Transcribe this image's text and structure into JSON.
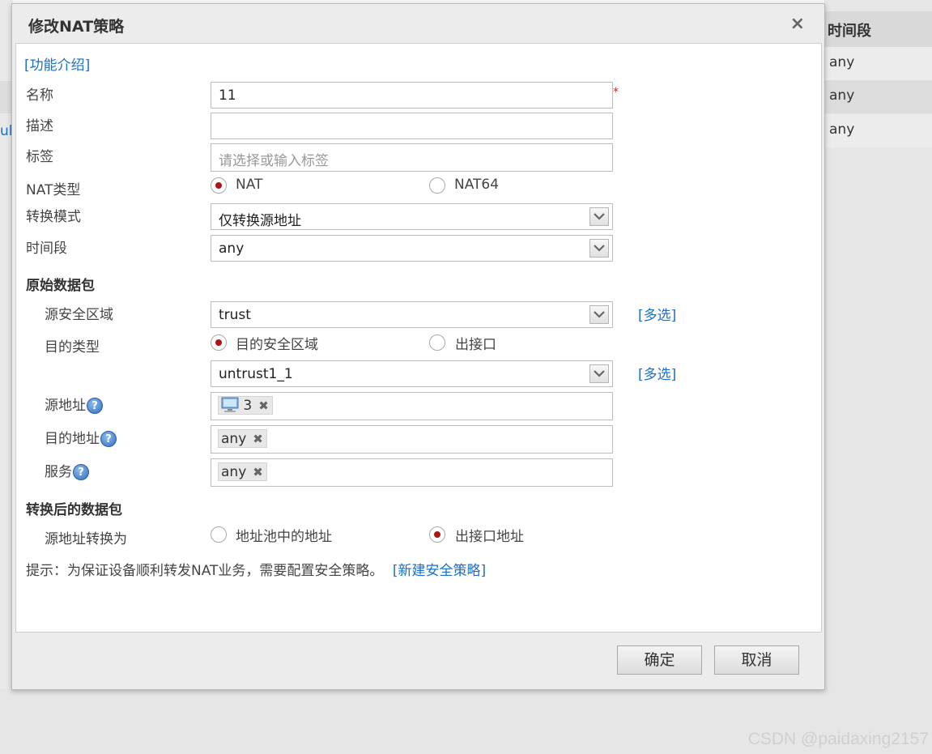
{
  "background": {
    "left_fragments": [
      "ul"
    ],
    "table_header": "时间段",
    "table_rows": [
      "any",
      "any",
      "any"
    ]
  },
  "dialog": {
    "title": "修改NAT策略",
    "close_label": "×",
    "intro_link": "[功能介绍]",
    "fields": {
      "name": {
        "label": "名称",
        "value": "11",
        "required_mark": "*"
      },
      "description": {
        "label": "描述",
        "value": ""
      },
      "tags": {
        "label": "标签",
        "placeholder": "请选择或输入标签"
      },
      "nat_type": {
        "label": "NAT类型",
        "options": [
          "NAT",
          "NAT64"
        ],
        "selected": "NAT"
      },
      "convert_mode": {
        "label": "转换模式",
        "value": "仅转换源地址"
      },
      "time_range": {
        "label": "时间段",
        "value": "any"
      }
    },
    "original_packet": {
      "title": "原始数据包",
      "source_zone": {
        "label": "源安全区域",
        "value": "trust",
        "multi_link": "[多选]"
      },
      "dest_type": {
        "label": "目的类型",
        "options": [
          "目的安全区域",
          "出接口"
        ],
        "selected": "目的安全区域"
      },
      "dest_zone": {
        "value": "untrust1_1",
        "multi_link": "[多选]"
      },
      "source_address": {
        "label": "源地址",
        "tags": [
          "3"
        ]
      },
      "dest_address": {
        "label": "目的地址",
        "tags": [
          "any"
        ]
      },
      "service": {
        "label": "服务",
        "tags": [
          "any"
        ]
      }
    },
    "converted_packet": {
      "title": "转换后的数据包",
      "source_convert": {
        "label": "源地址转换为",
        "options": [
          "地址池中的地址",
          "出接口地址"
        ],
        "selected": "出接口地址"
      }
    },
    "hint": {
      "text": "提示：为保证设备顺利转发NAT业务，需要配置安全策略。",
      "link": "[新建安全策略]"
    },
    "buttons": {
      "ok": "确定",
      "cancel": "取消"
    }
  },
  "watermark": "CSDN @paidaxing2157",
  "colors": {
    "link": "#1a6fc9",
    "radio_selected": "#b01414",
    "required": "#d62020"
  }
}
